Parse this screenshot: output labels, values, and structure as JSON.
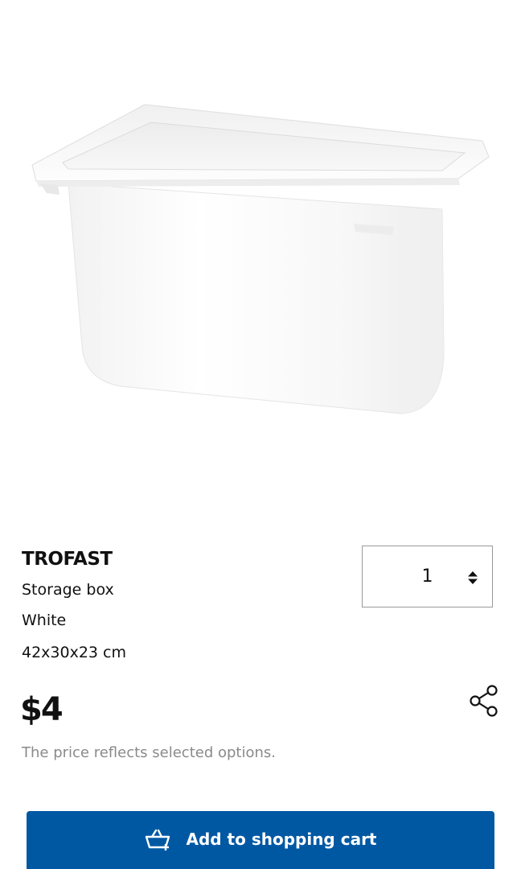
{
  "product": {
    "image_alt": "White storage box",
    "name": "TROFAST",
    "type": "Storage box",
    "color": "White",
    "size": "42x30x23 cm"
  },
  "quantity": {
    "value": "1",
    "arrows_icon": "up-down-arrows-icon"
  },
  "pricing": {
    "price": "$4",
    "note": "The price reflects selected options."
  },
  "share": {
    "icon": "share-icon"
  },
  "cart": {
    "label": "Add to shopping cart",
    "icon": "cart-add-icon",
    "background": "#0058a3"
  }
}
